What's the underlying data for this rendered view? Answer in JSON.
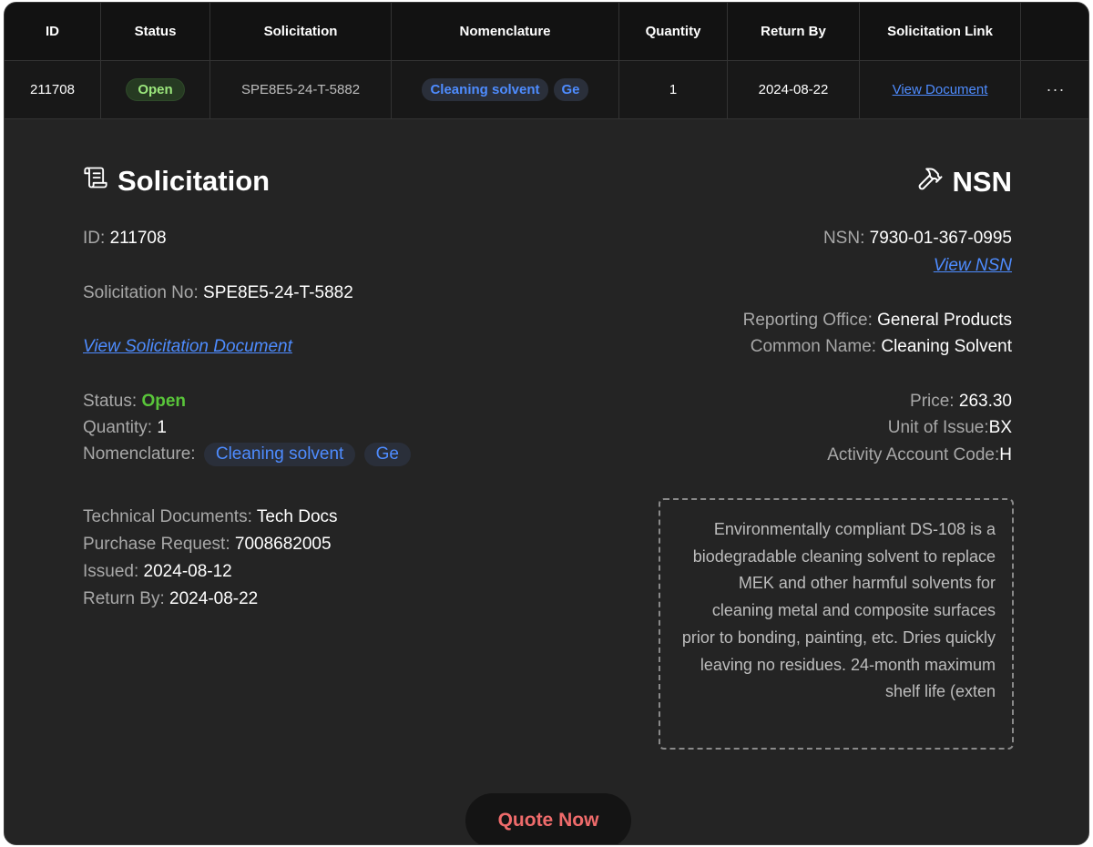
{
  "table": {
    "headers": [
      "ID",
      "Status",
      "Solicitation",
      "Nomenclature",
      "Quantity",
      "Return By",
      "Solicitation Link"
    ],
    "row": {
      "id": "211708",
      "status": "Open",
      "solicitation": "SPE8E5-24-T-5882",
      "nomenclature_chips": [
        "Cleaning solvent",
        "Ge"
      ],
      "quantity": "1",
      "return_by": "2024-08-22",
      "link_label": "View Document",
      "more": "···"
    }
  },
  "solicitation": {
    "title": "Solicitation",
    "id_label": "ID:",
    "id_value": "211708",
    "no_label": "Solicitation No:",
    "no_value": "SPE8E5-24-T-5882",
    "view_doc": "View Solicitation Document",
    "status_label": "Status:",
    "status_value": "Open",
    "qty_label": "Quantity:",
    "qty_value": "1",
    "nom_label": "Nomenclature:",
    "nom_chips": [
      "Cleaning solvent",
      "Ge"
    ],
    "tech_label": "Technical Documents:",
    "tech_value": "Tech Docs",
    "pr_label": "Purchase Request:",
    "pr_value": "7008682005",
    "issued_label": "Issued:",
    "issued_value": "2024-08-12",
    "return_label": "Return By:",
    "return_value": "2024-08-22"
  },
  "nsn": {
    "title": "NSN",
    "nsn_label": "NSN:",
    "nsn_value": "7930-01-367-0995",
    "view_nsn": "View NSN",
    "office_label": "Reporting Office:",
    "office_value": "General Products",
    "common_label": "Common Name:",
    "common_value": "Cleaning Solvent",
    "price_label": "Price:",
    "price_value": "263.30",
    "unit_label": "Unit of Issue:",
    "unit_value": "BX",
    "aac_label": "Activity Account Code:",
    "aac_value": "H",
    "description": "Environmentally compliant DS-108 is a biodegradable cleaning solvent to replace MEK and other harmful solvents for cleaning metal and composite surfaces prior to bonding, painting, etc. Dries quickly leaving no residues. 24-month maximum shelf life (exten"
  },
  "actions": {
    "quote_now": "Quote Now"
  },
  "colors": {
    "background": "#242424",
    "header_bg": "#121212",
    "link_blue": "#4e8cff",
    "open_green": "#59c53a",
    "quote_red": "#ef6b6b"
  },
  "icons": {
    "solicitation": "scroll-icon",
    "nsn": "hammer-icon",
    "more": "ellipsis-icon"
  }
}
